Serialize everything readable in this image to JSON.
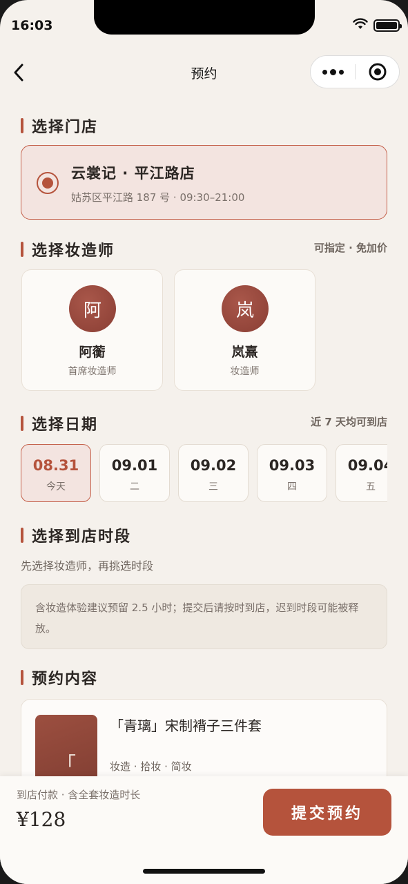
{
  "status": {
    "time": "16:03"
  },
  "nav": {
    "title": "预约"
  },
  "store_section": {
    "title": "选择门店"
  },
  "store": {
    "name": "云裳记 · 平江路店",
    "address": "姑苏区平江路 187 号 · 09:30–21:00",
    "selected": true
  },
  "artist_section": {
    "title": "选择妆造师",
    "aside": "可指定 · 免加价"
  },
  "artists": [
    {
      "avatar_char": "阿",
      "name": "阿蘅",
      "role": "首席妆造师"
    },
    {
      "avatar_char": "岚",
      "name": "岚熹",
      "role": "妆造师"
    }
  ],
  "date_section": {
    "title": "选择日期",
    "aside": "近 7 天均可到店"
  },
  "dates": [
    {
      "date": "08.31",
      "week": "今天",
      "active": true
    },
    {
      "date": "09.01",
      "week": "二"
    },
    {
      "date": "09.02",
      "week": "三"
    },
    {
      "date": "09.03",
      "week": "四"
    },
    {
      "date": "09.04",
      "week": "五"
    }
  ],
  "time_section": {
    "title": "选择到店时段",
    "hint": "先选择妆造师，再挑选时段"
  },
  "notice": "含妆造体验建议预留 2.5 小时；提交后请按时到店，迟到时段可能被释放。",
  "content_section": {
    "title": "预约内容"
  },
  "product": {
    "thumb_char": "「",
    "title": "「青璃」宋制褙子三件套",
    "tags": "妆造 · 拾妆 · 简妆"
  },
  "bottom": {
    "note": "到店付款 · 含全套妆造时长",
    "price": "¥128",
    "submit_label": "提交预约"
  },
  "colors": {
    "accent": "#b5533c",
    "background": "#f5f1ec"
  }
}
